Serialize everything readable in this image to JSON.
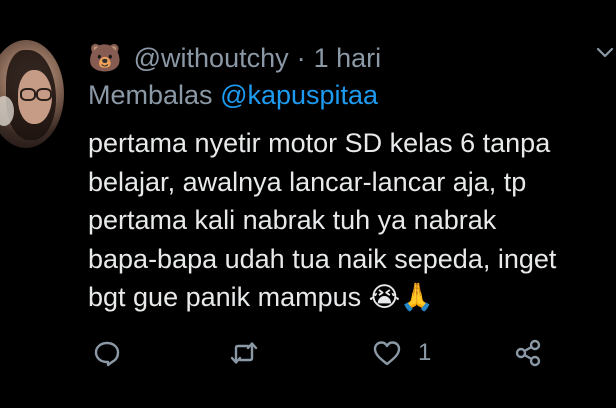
{
  "tweet": {
    "emoji": "🐻",
    "username": "@withoutchy",
    "separator": "·",
    "time": "1 hari",
    "reply_prefix": "Membalas",
    "reply_handle": "@kapuspitaa",
    "lines": [
      "pertama nyetir motor SD kelas 6 tanpa",
      "belajar, awalnya lancar-lancar aja, tp",
      "pertama kali nabrak tuh ya nabrak",
      "bapa-bapa udah tua naik sepeda, inget",
      "bgt gue panik mampus 😭🙏"
    ]
  },
  "actions": {
    "reply_icon": "comment-icon",
    "retweet_icon": "retweet-icon",
    "like_icon": "heart-icon",
    "like_count": "1",
    "share_icon": "share-icon"
  },
  "colors": {
    "background": "#000000",
    "text": "#e7e9ea",
    "muted": "#8b98a5",
    "link": "#1d9bf0"
  }
}
